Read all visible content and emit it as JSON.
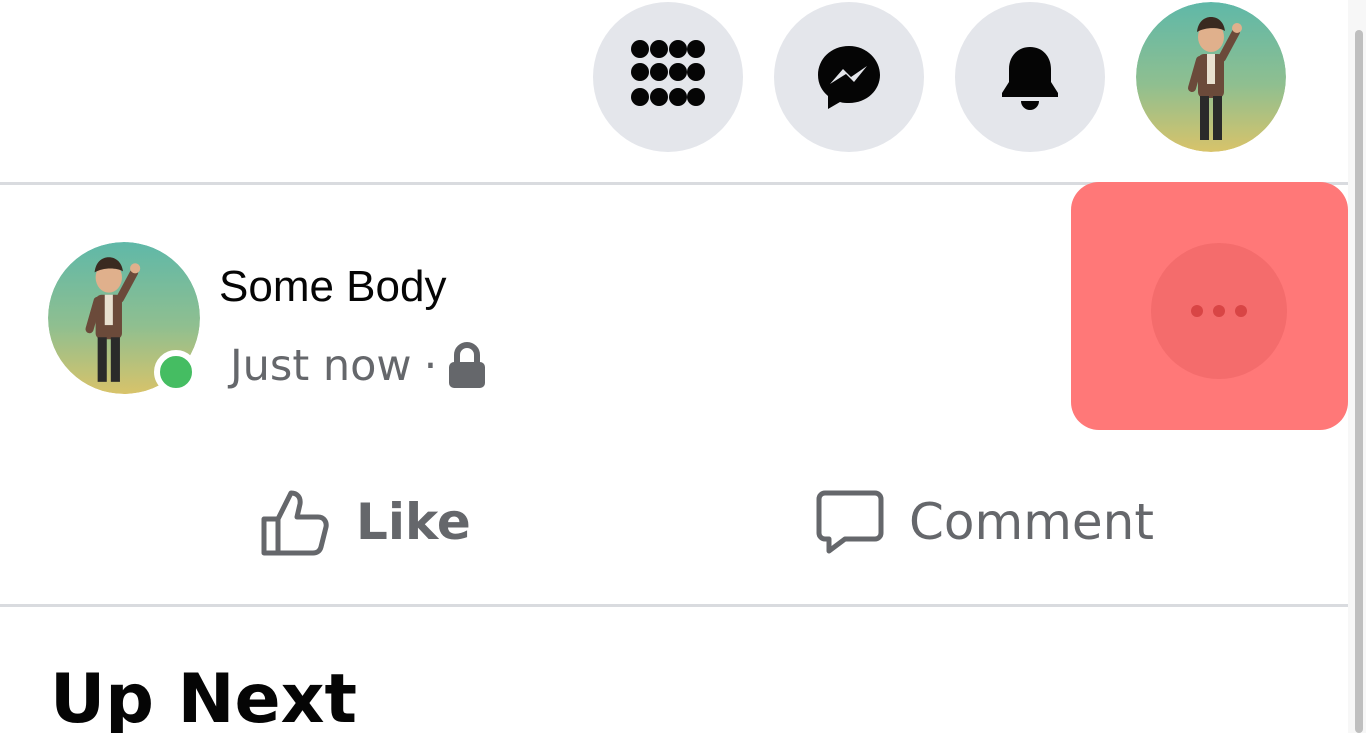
{
  "header": {
    "menu_icon": "grid-menu-icon",
    "messenger_icon": "messenger-icon",
    "notifications_icon": "bell-icon",
    "profile_avatar": "user-avatar"
  },
  "post": {
    "author_name": "Some Body",
    "timestamp": "Just now",
    "separator": "·",
    "privacy_icon": "lock-icon",
    "more_icon": "more-options-icon",
    "online_status_color": "#45bd62"
  },
  "actions": {
    "like_label": "Like",
    "comment_label": "Comment"
  },
  "section": {
    "up_next_title": "Up Next"
  },
  "colors": {
    "highlight": "#ff7878",
    "button_bg": "#e4e6eb",
    "muted_text": "#65676b"
  }
}
